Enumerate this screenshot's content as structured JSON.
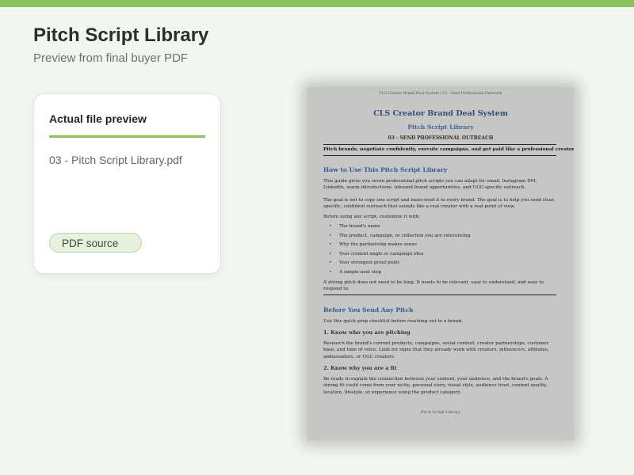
{
  "header": {
    "title": "Pitch Script Library",
    "subtitle": "Preview from final buyer PDF"
  },
  "card": {
    "title": "Actual file preview",
    "file_name": "03 - Pitch Script Library.pdf",
    "badge": "PDF source"
  },
  "colors": {
    "accent": "#86c45a",
    "heading_blue": "#2d5c98"
  },
  "document": {
    "running_header": "CLS Creator Brand Deal System | 03 - Send Professional Outreach",
    "title": "CLS Creator Brand Deal System",
    "subtitle": "Pitch Script Library",
    "step": "03 - SEND PROFESSIONAL OUTREACH",
    "tagline": "Pitch brands, negotiate confidently, execute campaigns, and get paid like a professional creator.",
    "section1": {
      "heading": "How to Use This Pitch Script Library",
      "para1": "This guide gives you seven professional pitch scripts you can adapt for email, Instagram DM, LinkedIn, warm introductions, inbound brand opportunities, and UGC-specific outreach.",
      "para2": "The goal is not to copy one script and mass-send it to every brand. The goal is to help you send clear, specific, confident outreach that sounds like a real creator with a real point of view.",
      "list_intro": "Before using any script, customize it with:",
      "list": [
        "The brand's name",
        "The product, campaign, or collection you are referencing",
        "Why the partnership makes sense",
        "Your content angle or campaign idea",
        "Your strongest proof point",
        "A simple next step"
      ],
      "closing": "A strong pitch does not need to be long. It needs to be relevant, easy to understand, and easy to respond to."
    },
    "section2": {
      "heading": "Before You Send Any Pitch",
      "intro": "Use this quick prep checklist before reaching out to a brand.",
      "sub1": "1. Know who you are pitching",
      "sub1_text": "Research the brand's current products, campaigns, social content, creator partnerships, customer base, and tone of voice. Look for signs that they already work with creators, influencers, affiliates, ambassadors, or UGC creators.",
      "sub2": "2. Know why you are a fit",
      "sub2_text": "Be ready to explain the connection between your content, your audience, and the brand's goals. A strong fit could come from your niche, personal story, visual style, audience trust, content quality, location, lifestyle, or experience using the product category."
    },
    "footer": "Pitch Script Library"
  }
}
